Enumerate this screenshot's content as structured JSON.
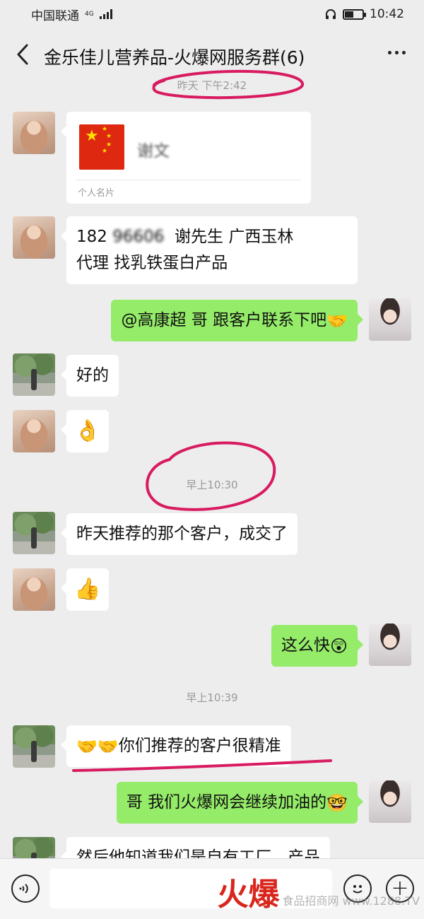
{
  "status_bar": {
    "carrier": "中国联通",
    "network": "4G",
    "time": "10:42"
  },
  "header": {
    "title": "金乐佳儿营养品-火爆网服务群(6)"
  },
  "messages": [
    {
      "type": "time",
      "text": "昨天 下午2:42"
    },
    {
      "type": "card",
      "side": "left",
      "avatar": "girl",
      "name": "谢文",
      "label": "个人名片"
    },
    {
      "type": "text",
      "side": "left",
      "avatar": "girl",
      "lines": [
        "182",
        "谢先生  广西玉林",
        "代理  找乳铁蛋白产品"
      ]
    },
    {
      "type": "text",
      "side": "right",
      "avatar": "girl2",
      "text": "@高康超  哥  跟客户联系下吧",
      "emoji": "🤝"
    },
    {
      "type": "text",
      "side": "left",
      "avatar": "park",
      "text": "好的"
    },
    {
      "type": "emoji",
      "side": "left",
      "avatar": "girl",
      "emoji": "👌"
    },
    {
      "type": "time",
      "text": "早上10:30"
    },
    {
      "type": "text",
      "side": "left",
      "avatar": "park",
      "text": "昨天推荐的那个客户，成交了"
    },
    {
      "type": "emoji",
      "side": "left",
      "avatar": "girl",
      "emoji": "👍"
    },
    {
      "type": "text",
      "side": "right",
      "avatar": "girl2",
      "text": "这么快",
      "emoji": "😲"
    },
    {
      "type": "time",
      "text": "早上10:39"
    },
    {
      "type": "text",
      "side": "left",
      "avatar": "park",
      "emoji_prefix": "🤝🤝",
      "text": "你们推荐的客户很精准"
    },
    {
      "type": "text",
      "side": "right",
      "avatar": "girl2",
      "text": "哥  我们火爆网会继续加油的",
      "emoji": "🤓"
    },
    {
      "type": "text",
      "side": "left",
      "avatar": "park",
      "text": "然后他知道我们是自有工厂，产品"
    }
  ],
  "input_bar": {
    "voice_icon": "voice-icon",
    "emoji_icon": "smiley-icon",
    "plus_icon": "plus-icon"
  },
  "watermark": {
    "brand": "火爆",
    "site": "食品招商网 www.1288.TV"
  },
  "colors": {
    "background": "#ededed",
    "bubble_self": "#95ec69",
    "bubble_other": "#ffffff",
    "annotation": "#d81b60",
    "flag_red": "#de2910"
  }
}
